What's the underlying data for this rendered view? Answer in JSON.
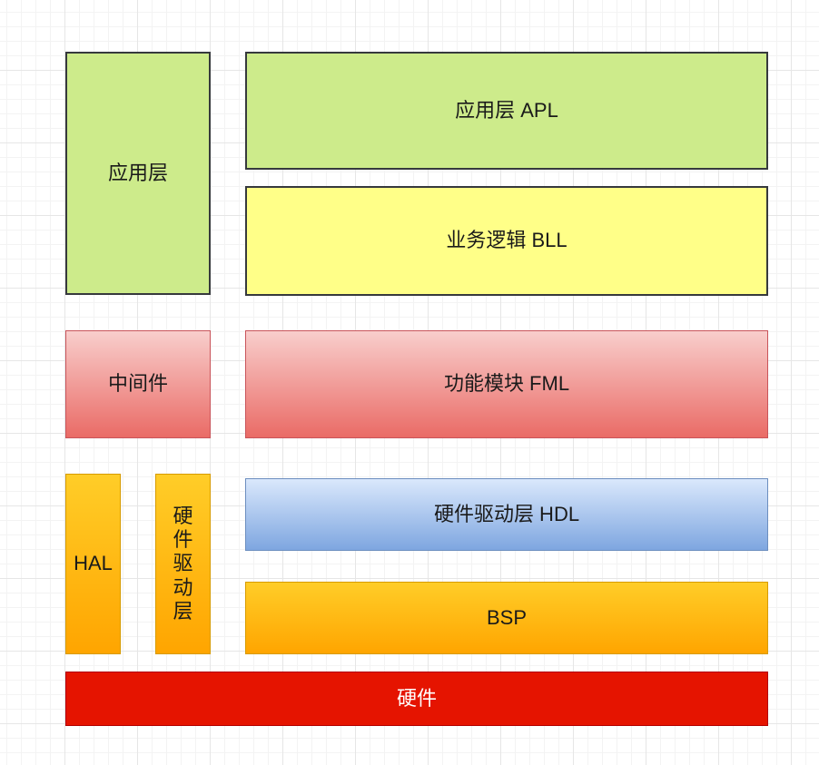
{
  "left_column": {
    "app_layer": "应用层",
    "middleware": "中间件",
    "hal": "HAL",
    "driver_layer": "硬件驱动层"
  },
  "right_column": {
    "apl": "应用层 APL",
    "bll": "业务逻辑 BLL",
    "fml": "功能模块 FML",
    "hdl": "硬件驱动层 HDL",
    "bsp": "BSP"
  },
  "bottom": {
    "hardware": "硬件"
  },
  "colors": {
    "app_green": "#cdeb8b",
    "bll_yellow": "#ffff88",
    "middleware_red": "#ea6b66",
    "hdl_blue": "#7ea6e0",
    "bsp_orange": "#ffa500",
    "hardware_red": "#e51400"
  }
}
